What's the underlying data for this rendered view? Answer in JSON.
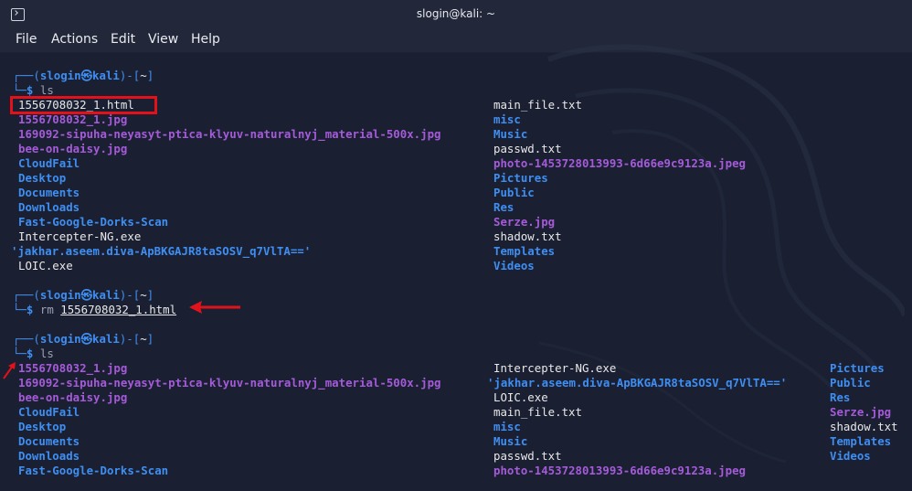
{
  "window": {
    "title": "slogin@kali: ~"
  },
  "menu": [
    "File",
    "Actions",
    "Edit",
    "View",
    "Help"
  ],
  "prompt": {
    "user": "slogin",
    "at": "㉿",
    "host": "kali",
    "dir": "~",
    "symbol": "$"
  },
  "commands": {
    "ls1": "ls",
    "rm": "rm",
    "rm_arg": "1556708032_1.html",
    "ls2": "ls"
  },
  "listing1": {
    "col1": [
      {
        "name": "1556708032_1.html",
        "type": "file"
      },
      {
        "name": "1556708032_1.jpg",
        "type": "image"
      },
      {
        "name": "169092-sipuha-neyasyt-ptica-klyuv-naturalnyj_material-500x.jpg",
        "type": "image"
      },
      {
        "name": "bee-on-daisy.jpg",
        "type": "image"
      },
      {
        "name": "CloudFail",
        "type": "dir"
      },
      {
        "name": "Desktop",
        "type": "dir"
      },
      {
        "name": "Documents",
        "type": "dir"
      },
      {
        "name": "Downloads",
        "type": "dir"
      },
      {
        "name": "Fast-Google-Dorks-Scan",
        "type": "dir"
      },
      {
        "name": "Intercepter-NG.exe",
        "type": "file"
      },
      {
        "name": "'jakhar.aseem.diva-ApBKGAJR8taSOSV_q7VlTA=='",
        "type": "dir"
      },
      {
        "name": "LOIC.exe",
        "type": "file"
      }
    ],
    "col2": [
      {
        "name": "main_file.txt",
        "type": "file"
      },
      {
        "name": "misc",
        "type": "dir"
      },
      {
        "name": "Music",
        "type": "dir"
      },
      {
        "name": "passwd.txt",
        "type": "file"
      },
      {
        "name": "photo-1453728013993-6d66e9c9123a.jpeg",
        "type": "image"
      },
      {
        "name": "Pictures",
        "type": "dir"
      },
      {
        "name": "Public",
        "type": "dir"
      },
      {
        "name": "Res",
        "type": "dir"
      },
      {
        "name": "Serze.jpg",
        "type": "image"
      },
      {
        "name": "shadow.txt",
        "type": "file"
      },
      {
        "name": "Templates",
        "type": "dir"
      },
      {
        "name": "Videos",
        "type": "dir"
      }
    ]
  },
  "listing2": {
    "col1": [
      {
        "name": "1556708032_1.jpg",
        "type": "image"
      },
      {
        "name": "169092-sipuha-neyasyt-ptica-klyuv-naturalnyj_material-500x.jpg",
        "type": "image"
      },
      {
        "name": "bee-on-daisy.jpg",
        "type": "image"
      },
      {
        "name": "CloudFail",
        "type": "dir"
      },
      {
        "name": "Desktop",
        "type": "dir"
      },
      {
        "name": "Documents",
        "type": "dir"
      },
      {
        "name": "Downloads",
        "type": "dir"
      },
      {
        "name": "Fast-Google-Dorks-Scan",
        "type": "dir"
      }
    ],
    "col2": [
      {
        "name": "Intercepter-NG.exe",
        "type": "file"
      },
      {
        "name": "'jakhar.aseem.diva-ApBKGAJR8taSOSV_q7VlTA=='",
        "type": "dir"
      },
      {
        "name": "LOIC.exe",
        "type": "file"
      },
      {
        "name": "main_file.txt",
        "type": "file"
      },
      {
        "name": "misc",
        "type": "dir"
      },
      {
        "name": "Music",
        "type": "dir"
      },
      {
        "name": "passwd.txt",
        "type": "file"
      },
      {
        "name": "photo-1453728013993-6d66e9c9123a.jpeg",
        "type": "image"
      }
    ],
    "col3": [
      {
        "name": "Pictures",
        "type": "dir"
      },
      {
        "name": "Public",
        "type": "dir"
      },
      {
        "name": "Res",
        "type": "dir"
      },
      {
        "name": "Serze.jpg",
        "type": "image"
      },
      {
        "name": "shadow.txt",
        "type": "file"
      },
      {
        "name": "Templates",
        "type": "dir"
      },
      {
        "name": "Videos",
        "type": "dir"
      }
    ]
  },
  "colors": {
    "directory": "#3f8ef2",
    "image": "#a55bd9",
    "file": "#e8e8ea",
    "highlight": "#e3121a",
    "background": "#1a2031"
  }
}
